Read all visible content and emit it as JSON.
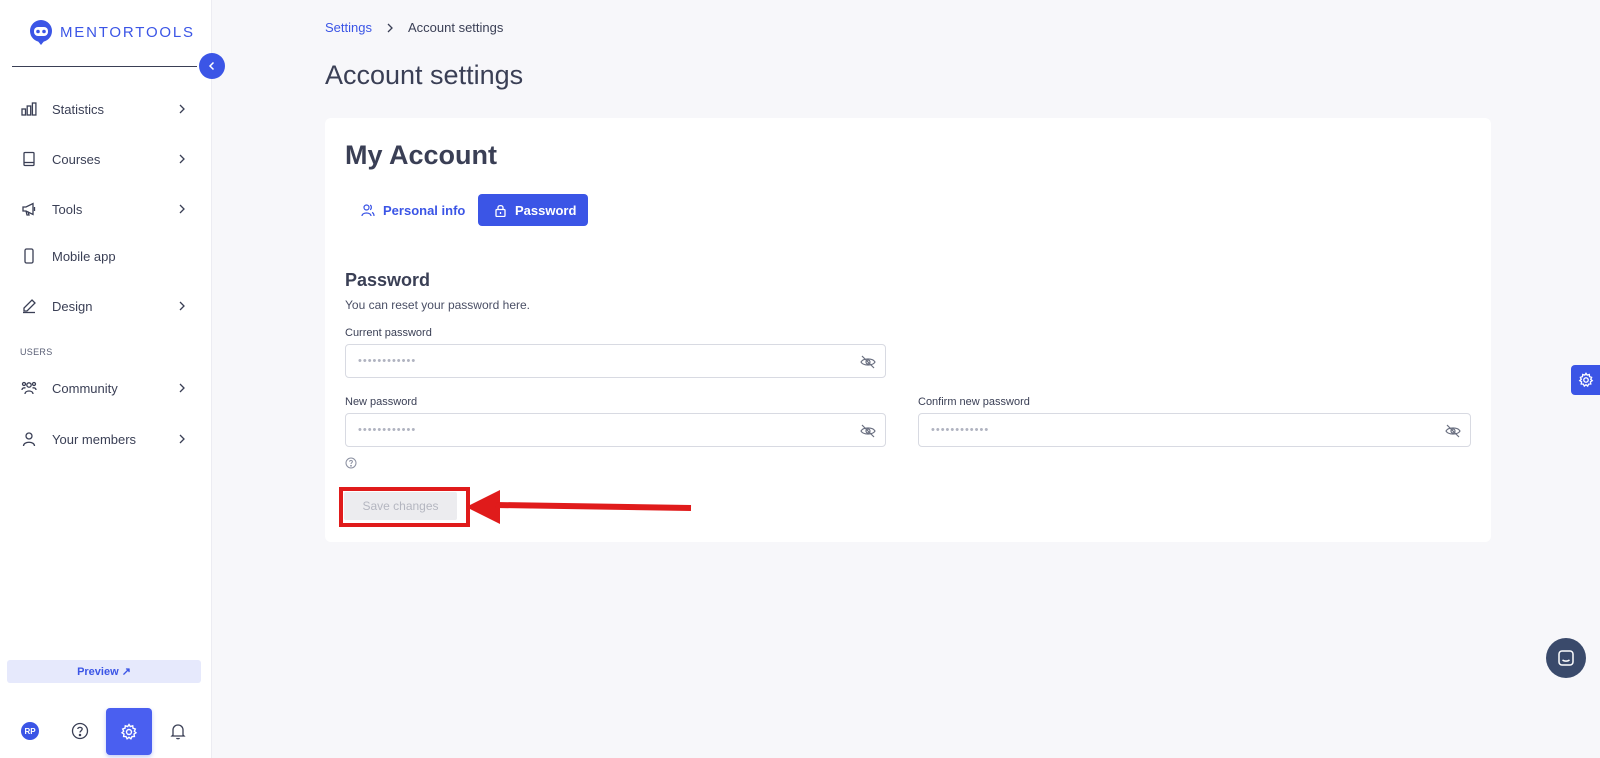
{
  "brand": {
    "name": "MENTORTOOLS"
  },
  "sidebar": {
    "items": [
      {
        "label": "Statistics",
        "icon": "bar-chart-icon",
        "has_chevron": true
      },
      {
        "label": "Courses",
        "icon": "book-icon",
        "has_chevron": true
      },
      {
        "label": "Tools",
        "icon": "megaphone-icon",
        "has_chevron": true
      },
      {
        "label": "Mobile app",
        "icon": "phone-icon",
        "has_chevron": false
      },
      {
        "label": "Design",
        "icon": "pencil-icon",
        "has_chevron": true
      }
    ],
    "users_section_label": "USERS",
    "users_items": [
      {
        "label": "Community",
        "icon": "community-icon",
        "has_chevron": true
      },
      {
        "label": "Your members",
        "icon": "user-icon",
        "has_chevron": true
      }
    ],
    "preview_label": "Preview ↗",
    "avatar_initials": "RP"
  },
  "breadcrumb": {
    "parent": "Settings",
    "current": "Account settings"
  },
  "page_title": "Account settings",
  "card": {
    "title": "My Account",
    "tabs": [
      {
        "label": "Personal info",
        "icon": "users-icon",
        "active": false
      },
      {
        "label": "Password",
        "icon": "lock-icon",
        "active": true
      }
    ],
    "section_title": "Password",
    "section_desc": "You can reset your password here.",
    "fields": {
      "current": {
        "label": "Current password",
        "value": "••••••••••••"
      },
      "new": {
        "label": "New password",
        "value": "••••••••••••"
      },
      "confirm": {
        "label": "Confirm new password",
        "value": "••••••••••••"
      }
    },
    "save_label": "Save changes"
  },
  "colors": {
    "accent": "#3b55e6",
    "highlight": "#e01b1b"
  }
}
